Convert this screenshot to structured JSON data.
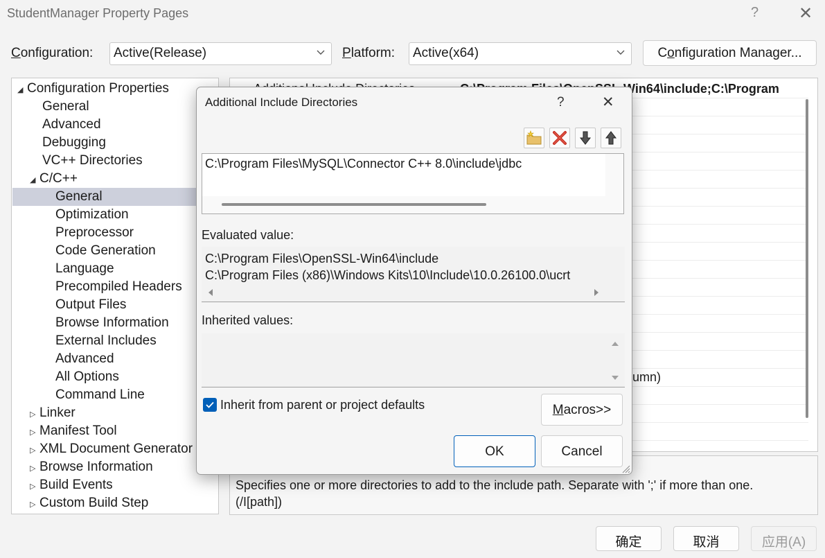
{
  "window": {
    "title": "StudentManager Property Pages",
    "help": "?",
    "close": "✕"
  },
  "toolbar": {
    "configuration_label_pre": "",
    "configuration_label_ul": "C",
    "configuration_label_post": "onfiguration:",
    "configuration_value": "Active(Release)",
    "platform_label_ul": "P",
    "platform_label_post": "latform:",
    "platform_value": "Active(x64)",
    "config_manager_pre": "C",
    "config_manager_ul": "o",
    "config_manager_post": "nfiguration Manager..."
  },
  "tree": {
    "items": [
      {
        "label": "Configuration Properties",
        "arrow": "◢"
      },
      {
        "label": "General"
      },
      {
        "label": "Advanced"
      },
      {
        "label": "Debugging"
      },
      {
        "label": "VC++ Directories"
      },
      {
        "label": "C/C++",
        "arrow": "◢"
      },
      {
        "label": "General"
      },
      {
        "label": "Optimization"
      },
      {
        "label": "Preprocessor"
      },
      {
        "label": "Code Generation"
      },
      {
        "label": "Language"
      },
      {
        "label": "Precompiled Headers"
      },
      {
        "label": "Output Files"
      },
      {
        "label": "Browse Information"
      },
      {
        "label": "External Includes"
      },
      {
        "label": "Advanced"
      },
      {
        "label": "All Options"
      },
      {
        "label": "Command Line"
      },
      {
        "label": "Linker",
        "arrow": "▷"
      },
      {
        "label": "Manifest Tool",
        "arrow": "▷"
      },
      {
        "label": "XML Document Generator",
        "arrow": "▷"
      },
      {
        "label": "Browse Information",
        "arrow": "▷"
      },
      {
        "label": "Build Events",
        "arrow": "▷"
      },
      {
        "label": "Custom Build Step",
        "arrow": "▷"
      }
    ]
  },
  "grid": {
    "first_row_name": "Additional Include Directories",
    "first_row_value": "C:\\Program Files\\OpenSSL-Win64\\include;C:\\Program",
    "partial_value": "umn)"
  },
  "description": {
    "line1": "Specifies one or more directories to add to the include path. Separate with ';' if more than one.",
    "line2": "(/I[path])"
  },
  "dialog": {
    "title": "Additional Include Directories",
    "help": "?",
    "close": "✕",
    "tool_icons": [
      "new-folder-icon",
      "delete-icon",
      "move-down-icon",
      "move-up-icon"
    ],
    "list_items": [
      "C:\\Program Files\\MySQL\\Connector C++ 8.0\\include\\jdbc"
    ],
    "evaluated_label": "Evaluated value:",
    "evaluated_lines": [
      "C:\\Program Files\\OpenSSL-Win64\\include",
      "C:\\Program Files (x86)\\Windows Kits\\10\\Include\\10.0.26100.0\\ucrt"
    ],
    "inherited_label": "Inherited values:",
    "inherit_checkbox_label": "Inherit from parent or project defaults",
    "inherit_checked": true,
    "macros_ul": "M",
    "macros_post": "acros>>",
    "ok": "OK",
    "cancel": "Cancel"
  },
  "footer": {
    "confirm": "确定",
    "cancel": "取消",
    "apply": "应用(A)"
  }
}
